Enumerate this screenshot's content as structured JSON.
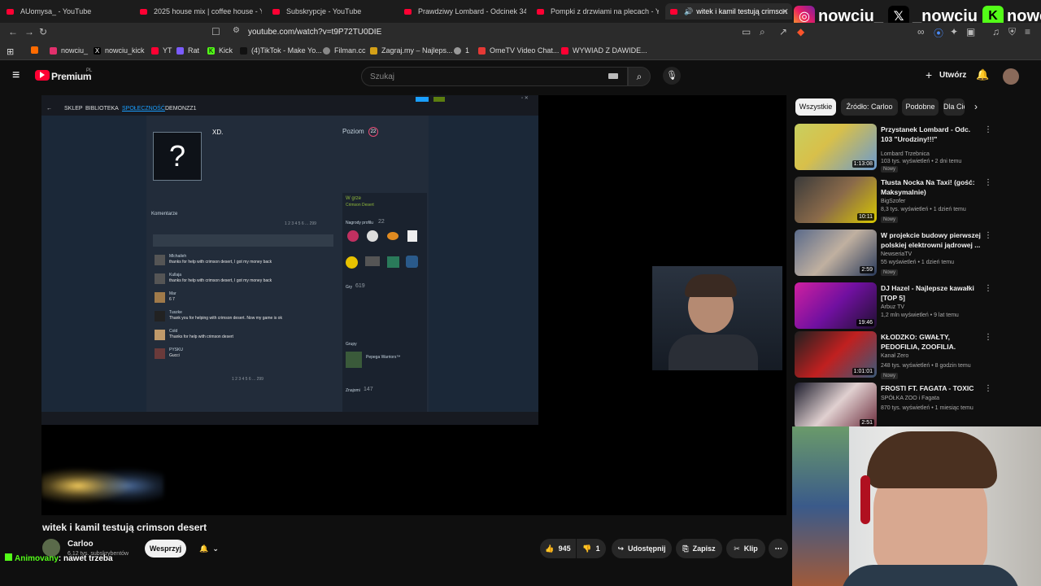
{
  "tabs": [
    {
      "label": "AUomysa_ - YouTube"
    },
    {
      "label": "2025 house mix | coffee house - YouTube"
    },
    {
      "label": "Subskrypcje - YouTube"
    },
    {
      "label": "Prawdziwy Lombard - Odcinek 340"
    },
    {
      "label": "Pompki z drzwiami na plecach - YouTube"
    },
    {
      "label": "witek i kamil testują crimson"
    }
  ],
  "url": "youtube.com/watch?v=t9P72TU0DIE",
  "bookmarks": [
    "nowciu_",
    "nowciu_kick",
    "YT",
    "Rat",
    "Kick",
    "(4)TikTok - Make Yo...",
    "Filman.cc",
    "Zagraj.my – Najleps...",
    "1",
    "OmeTV Video Chat...",
    "WYWIAD Z DAWIDE..."
  ],
  "social": {
    "instagram": "nowciu_",
    "x": "_nowciu",
    "kick": "nowciu"
  },
  "header": {
    "logo": "Premium",
    "region": "PL",
    "search_placeholder": "Szukaj",
    "create": "Utwórz"
  },
  "steam": {
    "nav": [
      "SKLEP",
      "BIBLIOTEKA",
      "SPOŁECZNOŚĆ",
      "DEMONZZ1"
    ],
    "username": "XD.",
    "level_label": "Poziom",
    "level": "22",
    "comments_title": "Komentarze",
    "comments": [
      {
        "name": "Mlchaileh",
        "text": "thanks for help with crimson desert, I got my money back"
      },
      {
        "name": "Kullaja",
        "text": "thanks for help with crimson desert, I got my money back"
      },
      {
        "name": "Mar",
        "text": "6 7"
      },
      {
        "name": "Tuszke",
        "text": "Thank you for helping with crimson desert. Now my game is ok"
      },
      {
        "name": "Cold",
        "text": "Thanks for help with crimson desert"
      },
      {
        "name": "PYSKU",
        "text": "Gucci"
      }
    ],
    "ingame": "W grze",
    "game": "Crimson Desert",
    "games_label": "Gry",
    "games": "619",
    "badges_label": "Nagrody profilu",
    "badges": "22",
    "groups_label": "Grupy",
    "group": "Pepega Warriors™",
    "friends_label": "Znajomi",
    "friends": "147",
    "pages": "1 2 3 4 5 6 ... 299"
  },
  "video": {
    "title": "witek i kamil testują crimson desert",
    "channel": "Carloo",
    "subs": "6,12 tys. subskrybentów",
    "support": "Wesprzyj",
    "likes": "945",
    "dislikes": "1",
    "share": "Udostępnij",
    "save": "Zapisz",
    "clip": "Klip"
  },
  "chat": {
    "user": "Animovany",
    "text": ": nawet trzeba"
  },
  "chips": [
    "Wszystkie",
    "Źródło: Carloo",
    "Podobne",
    "Dla Ciebie"
  ],
  "recs": [
    {
      "title": "Przystanek Lombard - Odc. 103 \"Urodziny!!!\"",
      "channel": "Lombard Trzebnica",
      "meta": "103 tys. wyświetleń • 2 dni temu",
      "badge": "Nowy",
      "duration": "1:13:08"
    },
    {
      "title": "Tłusta Nocka Na Taxi! (gość: Maksymalnie)",
      "channel": "BigSzofer",
      "meta": "8,3 tys. wyświetleń • 1 dzień temu",
      "badge": "Nowy",
      "duration": "10:11"
    },
    {
      "title": "W projekcie budowy pierwszej polskiej elektrowni jądrowej ...",
      "channel": "NewseriaTV",
      "meta": "55 wyświetleń • 1 dzień temu",
      "badge": "Nowy",
      "duration": "2:59"
    },
    {
      "title": "DJ Hazel - Najlepsze kawałki [TOP 5]",
      "channel": "Arbuz TV",
      "meta": "1,2 mln wyświetleń • 9 lat temu",
      "badge": "",
      "duration": "19:46"
    },
    {
      "title": "KŁODZKO: GWAŁTY, PEDOFILIA, ZOOFILIA. WSTRZĄSAJĄCE ...",
      "channel": "Kanał Zero",
      "meta": "248 tys. wyświetleń • 8 godzin temu",
      "badge": "Nowy",
      "duration": "1:01:01"
    },
    {
      "title": "FROSTI FT. FAGATA - TOXIC",
      "channel": "SPÓŁKA ZOO i Fagata",
      "meta": "870 tys. wyświetleń • 1 miesiąc temu",
      "badge": "",
      "duration": "2:51"
    }
  ]
}
